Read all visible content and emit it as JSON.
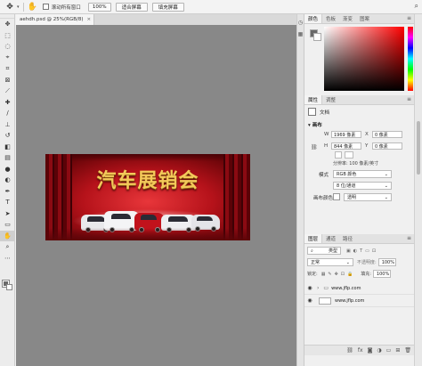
{
  "optionsbar": {
    "scroll_all_label": "滚动所有窗口",
    "zoom_value": "100%",
    "fit_screen_label": "适合屏幕",
    "fill_screen_label": "填充屏幕"
  },
  "document": {
    "tab_title": "aehdh.psd @ 25%(RGB/8)",
    "close_glyph": "×",
    "headline": "汽车展销会"
  },
  "color_panel": {
    "tabs": [
      "颜色",
      "色板",
      "渐变",
      "图案"
    ]
  },
  "properties_panel": {
    "tabs": [
      "属性",
      "调整"
    ],
    "doc_label": "文档",
    "canvas_section": "画布",
    "width_label": "W",
    "width_value": "1969 像素",
    "height_label": "H",
    "height_value": "844 像素",
    "x_label": "X",
    "x_value": "0 像素",
    "y_label": "Y",
    "y_value": "0 像素",
    "resolution": "分辨率: 100 像素/英寸",
    "mode_label": "模式",
    "mode_value": "RGB 颜色",
    "depth_value": "8 位/通道",
    "bg_label": "画布颜色",
    "bg_value": "透明"
  },
  "layers_panel": {
    "tabs": [
      "图层",
      "通道",
      "路径"
    ],
    "filter_kind": "类型",
    "blend_mode": "正常",
    "opacity_label": "不透明度:",
    "opacity_value": "100%",
    "lock_label": "锁定:",
    "fill_label": "填充:",
    "fill_value": "100%",
    "layers": [
      {
        "name": "www.jflp.com",
        "type": "group"
      },
      {
        "name": "www.jflp.com",
        "type": "layer"
      }
    ]
  },
  "icons": {
    "move_tool": "move-icon",
    "hand_tool": "hand-icon",
    "eye": "eye-icon"
  },
  "colors": {
    "banner_red": "#c8141c",
    "headline_gold": "#f3c95a",
    "canvas_bg": "#888888"
  }
}
